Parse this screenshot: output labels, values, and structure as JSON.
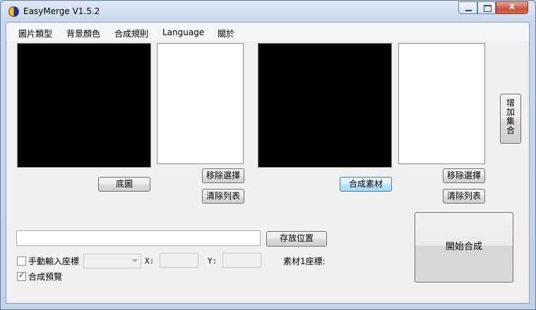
{
  "window": {
    "title": "EasyMerge V1.5.2",
    "controls": {
      "close": "x"
    }
  },
  "menu": {
    "items": [
      "圖片類型",
      "背景顏色",
      "合成規則",
      "Language",
      "關於"
    ]
  },
  "left_panel": {
    "base_button": "底圖",
    "remove_button": "移除選擇",
    "clear_button": "清除列表"
  },
  "right_panel": {
    "material_button": "合成素材",
    "remove_button": "移除選擇",
    "clear_button": "清除列表"
  },
  "side": {
    "add_set_button": "增加集合"
  },
  "output": {
    "path_value": "",
    "save_location_button": "存放位置",
    "start_button": "開始合成"
  },
  "options": {
    "manual_coords_label": "手動輸入座標",
    "manual_coords_checked": false,
    "coord_select_value": "",
    "x_label": "X:",
    "x_value": "",
    "y_label": "Y:",
    "y_value": "",
    "material_coord_label": "素材1座標:",
    "preview_label": "合成預覽",
    "preview_checked": true,
    "check_glyph": "✓"
  },
  "colors": {
    "image_area": "#000000",
    "list_area": "#ffffff",
    "focus_border": "#3c7fb1"
  }
}
